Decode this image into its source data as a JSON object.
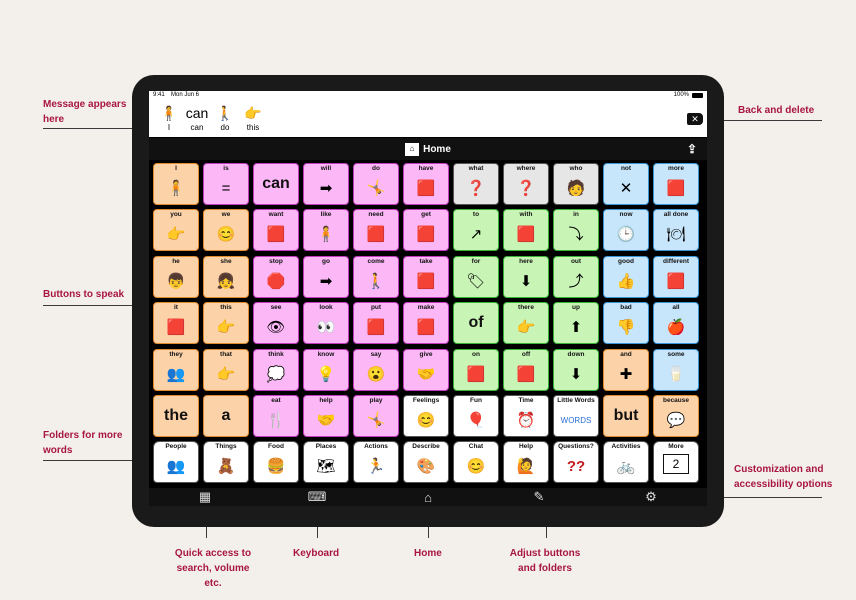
{
  "annotations": {
    "message": "Message appears here",
    "back_delete": "Back and delete",
    "buttons_speak": "Buttons to speak",
    "folders": "Folders for more words",
    "customization": "Customization and accessibility options",
    "quick_access": "Quick access to search, volume etc.",
    "keyboard": "Keyboard",
    "home": "Home",
    "adjust": "Adjust buttons and folders"
  },
  "status": {
    "time": "9:41",
    "date": "Mon Jun 6",
    "battery": "100%"
  },
  "message_words": [
    {
      "label": "I",
      "icon": "🧍"
    },
    {
      "label": "can",
      "icon": "can"
    },
    {
      "label": "do",
      "icon": "🚶"
    },
    {
      "label": "this",
      "icon": "👉"
    }
  ],
  "home_title": "Home",
  "grid": [
    [
      {
        "label": "I",
        "color": "orange",
        "icon": "🧍"
      },
      {
        "label": "is",
        "color": "pink",
        "icon": "="
      },
      {
        "label": "can",
        "color": "pink",
        "icon": "can",
        "big": true
      },
      {
        "label": "will",
        "color": "pink",
        "icon": "➡"
      },
      {
        "label": "do",
        "color": "pink",
        "icon": "🤸"
      },
      {
        "label": "have",
        "color": "pink",
        "icon": "🟥"
      },
      {
        "label": "what",
        "color": "gray",
        "icon": "❓"
      },
      {
        "label": "where",
        "color": "gray",
        "icon": "❓"
      },
      {
        "label": "who",
        "color": "gray",
        "icon": "🧑"
      },
      {
        "label": "not",
        "color": "blue",
        "icon": "✕"
      },
      {
        "label": "more",
        "color": "blue",
        "icon": "🟥"
      }
    ],
    [
      {
        "label": "you",
        "color": "orange",
        "icon": "👉"
      },
      {
        "label": "we",
        "color": "orange",
        "icon": "😊"
      },
      {
        "label": "want",
        "color": "pink",
        "icon": "🟥"
      },
      {
        "label": "like",
        "color": "pink",
        "icon": "🧍"
      },
      {
        "label": "need",
        "color": "pink",
        "icon": "🟥"
      },
      {
        "label": "get",
        "color": "pink",
        "icon": "🟥"
      },
      {
        "label": "to",
        "color": "green",
        "icon": "↗"
      },
      {
        "label": "with",
        "color": "green",
        "icon": "🟥"
      },
      {
        "label": "in",
        "color": "green",
        "icon": "⤵"
      },
      {
        "label": "now",
        "color": "blue",
        "icon": "🕒"
      },
      {
        "label": "all done",
        "color": "blue",
        "icon": "🍽"
      }
    ],
    [
      {
        "label": "he",
        "color": "orange",
        "icon": "👦"
      },
      {
        "label": "she",
        "color": "orange",
        "icon": "👧"
      },
      {
        "label": "stop",
        "color": "pink",
        "icon": "🛑"
      },
      {
        "label": "go",
        "color": "pink",
        "icon": "➡"
      },
      {
        "label": "come",
        "color": "pink",
        "icon": "🚶"
      },
      {
        "label": "take",
        "color": "pink",
        "icon": "🟥"
      },
      {
        "label": "for",
        "color": "green",
        "icon": "🏷"
      },
      {
        "label": "here",
        "color": "green",
        "icon": "⬇"
      },
      {
        "label": "out",
        "color": "green",
        "icon": "⤴"
      },
      {
        "label": "good",
        "color": "blue",
        "icon": "👍"
      },
      {
        "label": "different",
        "color": "blue",
        "icon": "🟥"
      }
    ],
    [
      {
        "label": "it",
        "color": "orange",
        "icon": "🟥"
      },
      {
        "label": "this",
        "color": "orange",
        "icon": "👉"
      },
      {
        "label": "see",
        "color": "pink",
        "icon": "👁"
      },
      {
        "label": "look",
        "color": "pink",
        "icon": "👀"
      },
      {
        "label": "put",
        "color": "pink",
        "icon": "🟥"
      },
      {
        "label": "make",
        "color": "pink",
        "icon": "🟥"
      },
      {
        "label": "of",
        "color": "green",
        "icon": "of",
        "big": true
      },
      {
        "label": "there",
        "color": "green",
        "icon": "👉"
      },
      {
        "label": "up",
        "color": "green",
        "icon": "⬆"
      },
      {
        "label": "bad",
        "color": "blue",
        "icon": "👎"
      },
      {
        "label": "all",
        "color": "blue",
        "icon": "🍎"
      }
    ],
    [
      {
        "label": "they",
        "color": "orange",
        "icon": "👥"
      },
      {
        "label": "that",
        "color": "orange",
        "icon": "👉"
      },
      {
        "label": "think",
        "color": "pink",
        "icon": "💭"
      },
      {
        "label": "know",
        "color": "pink",
        "icon": "💡"
      },
      {
        "label": "say",
        "color": "pink",
        "icon": "😮"
      },
      {
        "label": "give",
        "color": "pink",
        "icon": "🤝"
      },
      {
        "label": "on",
        "color": "green",
        "icon": "🟥"
      },
      {
        "label": "off",
        "color": "green",
        "icon": "🟥"
      },
      {
        "label": "down",
        "color": "green",
        "icon": "⬇"
      },
      {
        "label": "and",
        "color": "orange",
        "icon": "✚"
      },
      {
        "label": "some",
        "color": "blue",
        "icon": "🥛"
      }
    ],
    [
      {
        "label": "the",
        "color": "orange",
        "icon": "the",
        "big": true
      },
      {
        "label": "a",
        "color": "orange",
        "icon": "a",
        "big": true
      },
      {
        "label": "eat",
        "color": "pink",
        "icon": "🍴"
      },
      {
        "label": "help",
        "color": "pink",
        "icon": "🤝"
      },
      {
        "label": "play",
        "color": "pink",
        "icon": "🤸"
      },
      {
        "label": "Feelings",
        "color": "white",
        "icon": "😊"
      },
      {
        "label": "Fun",
        "color": "white",
        "icon": "🎈"
      },
      {
        "label": "Time",
        "color": "white",
        "icon": "⏰"
      },
      {
        "label": "Little Words",
        "color": "white",
        "icon": "WORDS"
      },
      {
        "label": "but",
        "color": "orange",
        "icon": "but",
        "big": true
      },
      {
        "label": "because",
        "color": "orange",
        "icon": "💬"
      }
    ],
    [
      {
        "label": "People",
        "color": "folder",
        "icon": "👥"
      },
      {
        "label": "Things",
        "color": "folder",
        "icon": "🧸"
      },
      {
        "label": "Food",
        "color": "folder",
        "icon": "🍔"
      },
      {
        "label": "Places",
        "color": "folder",
        "icon": "🗺"
      },
      {
        "label": "Actions",
        "color": "folder",
        "icon": "🏃"
      },
      {
        "label": "Describe",
        "color": "folder",
        "icon": "🎨"
      },
      {
        "label": "Chat",
        "color": "folder",
        "icon": "😊"
      },
      {
        "label": "Help",
        "color": "folder",
        "icon": "🙋"
      },
      {
        "label": "Questions?",
        "color": "folder",
        "icon": "??"
      },
      {
        "label": "Activities",
        "color": "folder",
        "icon": "🚲"
      },
      {
        "label": "More",
        "color": "folder",
        "icon": "2"
      }
    ]
  ]
}
